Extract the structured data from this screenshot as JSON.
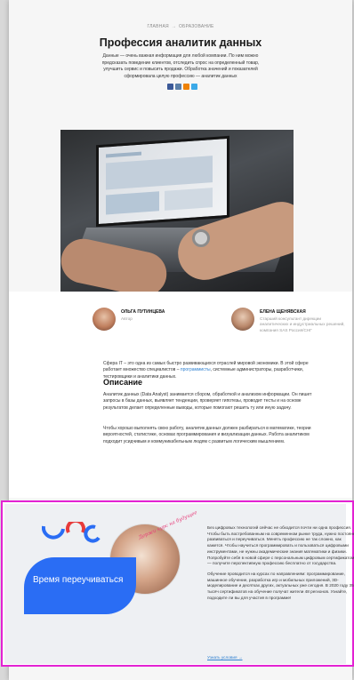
{
  "breadcrumb": {
    "home": "ГЛАВНАЯ",
    "section": "ОБРАЗОВАНИЕ",
    "separator": "→"
  },
  "title": "Профессия аналитик данных",
  "lead": "Данные — очень важная информация для любой компании. По ним можно предсказать поведение клиентов, отследить спрос на определенный товар, улучшить сервис и повысить продажи. Обработка значений и показателей сформировала целую профессию — аналитик данных",
  "share_colors": [
    "#3b5998",
    "#5b7fa8",
    "#ee8208",
    "#3ba9e8"
  ],
  "authors": [
    {
      "name": "ОЛЬГА ПУТИНЦЕВА",
      "role": "Автор"
    },
    {
      "name": "ЕЛЕНА ЩЕНЯВСКАЯ",
      "role": "Старший консультант дирекции аналитических и индустриальных решений, компания SAS Россия/СНГ"
    }
  ],
  "intro": {
    "text_before": "Сфера IT – это одна из самых быстро развивающихся отраслей мировой экономики. В этой сфере работает множество специалистов – ",
    "link": "программисты",
    "text_after": ", системные администраторы, разработчики, тестировщики и аналитики данных."
  },
  "section_heading": "Описание",
  "description": [
    "Аналитик данных (Data Analyst) занимается сбором, обработкой и анализом информации. Он пишет запросы в базы данных, выявляет тенденции, проверяет гипотезы, проводит тесты и на основе результатов делает определенные выводы, которые помогают решить ту или иную задачу.",
    "Чтобы хорошо выполнять свою работу, аналитик данных должен разбираться в математике, теории вероятностей, статистике, основах программирования и визуализации данных. Работа аналитиком подходит усидчивым и коммуникабельным людям с развитым логическим мышлением."
  ],
  "promo": {
    "banner_text": "Время переучиваться",
    "tagline": "Держи курс на будущее",
    "paragraphs": [
      "Без цифровых технологий сейчас не обходится почти ни одна профессия. Чтобы быть востребованным на современном рынке труда, нужно постоянно развиваться и переучиваться. Менять профессию не так сложно, как кажется. Чтобы научиться программировать и пользоваться цифровыми инструментами, не нужны академические знания математики и физики. Попробуйте себя в новой сфере с персональным цифровым сертификатом — получите перспективную профессию бесплатно от государства.",
      "Обучение проводится на курсах по направлениям: программирование, машинное обучение, разработка игр и мобильных приложений, 3D-моделирование и десятках других, актуальных уже сегодня. В 2020 году 35 тысяч сертификатов на обучение получат жители 48 регионов. Узнайте, подходите ли вы для участия в программе!"
    ],
    "link": "Узнать условия →",
    "accent": "#2a6df4",
    "highlight_border": "#e322d3"
  }
}
